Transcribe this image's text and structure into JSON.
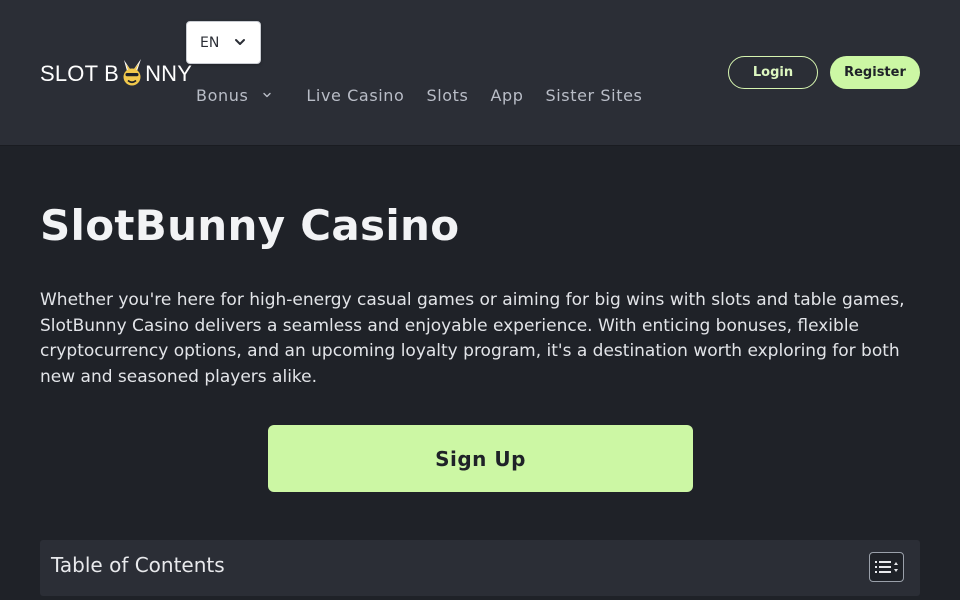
{
  "colors": {
    "page_bg": "#1f2228",
    "header_bg": "#2b2e36",
    "accent": "#ccf7a4",
    "text": "#e6e7ea"
  },
  "header": {
    "logo": {
      "text_left": "SLOT B",
      "text_right": "NNY",
      "icon": "bunny-head-icon"
    },
    "language": {
      "selected": "EN",
      "icon": "chevron-down-icon"
    },
    "nav": [
      {
        "label": "Bonus",
        "has_dropdown": true
      },
      {
        "label": "Live Casino"
      },
      {
        "label": "Slots"
      },
      {
        "label": "App"
      },
      {
        "label": "Sister Sites"
      }
    ],
    "login_label": "Login",
    "register_label": "Register"
  },
  "main": {
    "title": "SlotBunny Casino",
    "intro": "Whether you're here for high-energy casual games or aiming for big wins with slots and table games, SlotBunny Casino delivers a seamless and enjoyable experience. With enticing bonuses, flexible cryptocurrency options, and an upcoming loyalty program, it's a destination worth exploring for both new and seasoned players alike.",
    "signup_label": "Sign Up",
    "toc": {
      "title": "Table of Contents",
      "toggle_icon": "list-toggle-icon"
    }
  }
}
